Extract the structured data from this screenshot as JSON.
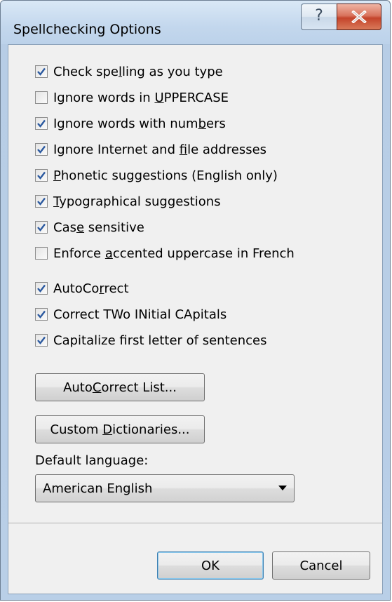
{
  "window": {
    "title": "Spellchecking Options",
    "help_glyph": "?",
    "close_icon": "close-icon"
  },
  "options_group_1": [
    {
      "before": "Check spe",
      "access": "l",
      "after": "ling as you type",
      "checked": true
    },
    {
      "before": "Ignore words in ",
      "access": "U",
      "after": "PPERCASE",
      "checked": false
    },
    {
      "before": "Ignore words with num",
      "access": "b",
      "after": "ers",
      "checked": true
    },
    {
      "before": "Ignore Internet and ",
      "access": "f",
      "after": "ile addresses",
      "checked": true
    },
    {
      "before": "",
      "access": "P",
      "after": "honetic suggestions (English only)",
      "checked": true
    },
    {
      "before": "",
      "access": "T",
      "after": "ypographical suggestions",
      "checked": true
    },
    {
      "before": "Cas",
      "access": "e",
      "after": " sensitive",
      "checked": true
    },
    {
      "before": "Enforce ",
      "access": "a",
      "after": "ccented uppercase in French",
      "checked": false
    }
  ],
  "options_group_2": [
    {
      "before": "AutoCo",
      "access": "r",
      "after": "rect",
      "checked": true
    },
    {
      "before": "Correct TWo INitial CApitals",
      "access": "",
      "after": "",
      "checked": true
    },
    {
      "before": "Capitalize first letter of sentences",
      "access": "",
      "after": "",
      "checked": true
    }
  ],
  "buttons": {
    "autocorrect_list": {
      "before": "Auto",
      "access": "C",
      "after": "orrect List..."
    },
    "custom_dictionaries": {
      "before": "Custom ",
      "access": "D",
      "after": "ictionaries..."
    },
    "ok": "OK",
    "cancel": "Cancel"
  },
  "default_language": {
    "label": "Default language:",
    "selected": "American English"
  },
  "colors": {
    "check": "#2c5aa0",
    "close_button": "#c4442b"
  }
}
